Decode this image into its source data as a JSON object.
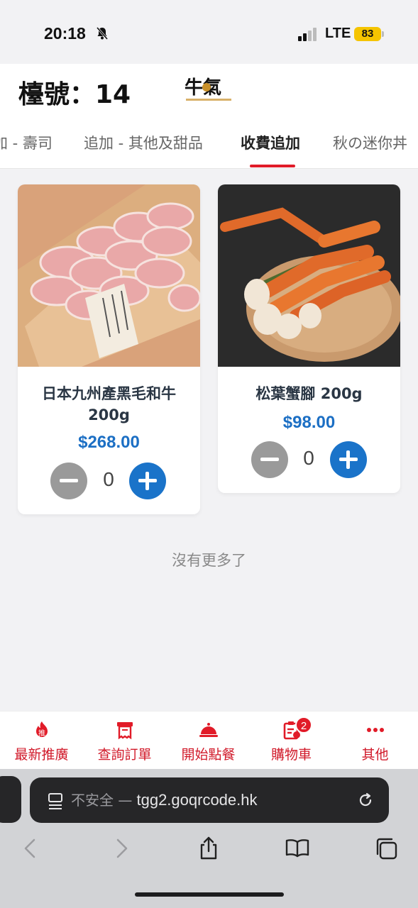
{
  "status_bar": {
    "time": "20:18",
    "network": "LTE",
    "battery": "83"
  },
  "header": {
    "table_label": "檯號：14",
    "logo_text": "牛氣"
  },
  "tabs": [
    {
      "label": "加 - 壽司"
    },
    {
      "label": "追加 - 其他及甜品"
    },
    {
      "label": "收費追加",
      "active": true
    },
    {
      "label": "秋の迷你丼"
    }
  ],
  "products": [
    {
      "name": "日本九州產黑毛和牛 200g",
      "price": "$268.00",
      "qty": "0"
    },
    {
      "name": "松葉蟹腳 200g",
      "price": "$98.00",
      "qty": "0"
    }
  ],
  "list_end_text": "沒有更多了",
  "bottom_nav": [
    {
      "label": "最新推廣",
      "icon": "hot-promo-icon",
      "icon_char": "推"
    },
    {
      "label": "查詢訂單",
      "icon": "receipt-icon"
    },
    {
      "label": "開始點餐",
      "icon": "cloche-icon"
    },
    {
      "label": "購物車",
      "icon": "cart-clipboard-icon",
      "badge": "2"
    },
    {
      "label": "其他",
      "icon": "more-dots-icon"
    }
  ],
  "browser": {
    "security_label": "不安全 —",
    "url": "tgg2.goqrcode.hk"
  },
  "colors": {
    "accent_red": "#e11b28",
    "price_blue": "#1c6fc4",
    "plus_blue": "#1a73c9",
    "minus_gray": "#9a9a9a"
  }
}
